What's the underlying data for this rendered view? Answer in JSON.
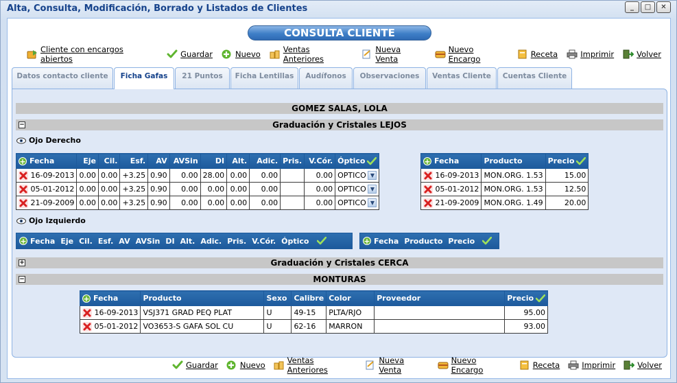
{
  "window": {
    "title": "Alta, Consulta, Modificación, Borrado y Listados de Clientes",
    "buttons": [
      "_",
      "□",
      "✕"
    ]
  },
  "header": {
    "title": "CONSULTA CLIENTE"
  },
  "toolbar_top": [
    {
      "label": "Cliente con encargos abiertos",
      "icon": "open-orders-icon"
    },
    {
      "label": "Guardar",
      "icon": "check-icon"
    },
    {
      "label": "Nuevo",
      "icon": "plus-icon"
    },
    {
      "label": "Ventas Anteriores",
      "icon": "previous-sales-icon"
    },
    {
      "label": "Nueva Venta",
      "icon": "new-sale-icon"
    },
    {
      "label": "Nuevo Encargo",
      "icon": "new-order-icon"
    },
    {
      "label": "Receta",
      "icon": "prescription-icon"
    },
    {
      "label": "Imprimir",
      "icon": "printer-icon"
    },
    {
      "label": "Volver",
      "icon": "exit-icon"
    }
  ],
  "toolbar_bottom": [
    {
      "label": "Guardar",
      "icon": "check-icon"
    },
    {
      "label": "Nuevo",
      "icon": "plus-icon"
    },
    {
      "label": "Ventas Anteriores",
      "icon": "previous-sales-icon"
    },
    {
      "label": "Nueva Venta",
      "icon": "new-sale-icon"
    },
    {
      "label": "Nuevo Encargo",
      "icon": "new-order-icon"
    },
    {
      "label": "Receta",
      "icon": "prescription-icon"
    },
    {
      "label": "Imprimir",
      "icon": "printer-icon"
    },
    {
      "label": "Volver",
      "icon": "exit-icon"
    }
  ],
  "tabs": [
    {
      "label": "Datos contacto cliente",
      "active": false
    },
    {
      "label": "Ficha Gafas",
      "active": true
    },
    {
      "label": "21 Puntos",
      "active": false
    },
    {
      "label": "Ficha Lentillas",
      "active": false
    },
    {
      "label": "Audífonos",
      "active": false
    },
    {
      "label": "Observaciones",
      "active": false
    },
    {
      "label": "Ventas Cliente",
      "active": false
    },
    {
      "label": "Cuentas Cliente",
      "active": false
    }
  ],
  "client_name": "GOMEZ SALAS, LOLA",
  "sections": {
    "lejos": {
      "title": "Graduación y Cristales LEJOS",
      "toggle": "−"
    },
    "cerca": {
      "title": "Graduación y Cristales CERCA",
      "toggle": "+"
    },
    "monturas": {
      "title": "MONTURAS",
      "toggle": "−"
    }
  },
  "ojo_derecho": {
    "label": "Ojo Derecho",
    "graduacion_headers": [
      "Fecha",
      "Eje",
      "Cil.",
      "Esf.",
      "AV",
      "AVSin",
      "DI",
      "Alt.",
      "Adic.",
      "Pris.",
      "V.Cór.",
      "Óptico"
    ],
    "graduacion_rows": [
      [
        "16-09-2013",
        "0.00",
        "0.00",
        "+3.25",
        "0.90",
        "0.00",
        "28.00",
        "0.00",
        "0.00",
        "",
        "0.00",
        "OPTICO"
      ],
      [
        "05-01-2012",
        "0.00",
        "0.00",
        "+3.25",
        "0.90",
        "0.00",
        "0.00",
        "0.00",
        "0.00",
        "",
        "0.00",
        "OPTICO"
      ],
      [
        "21-09-2009",
        "0.00",
        "0.00",
        "+3.25",
        "0.90",
        "0.00",
        "0.00",
        "0.00",
        "0.00",
        "",
        "0.00",
        "OPTICO"
      ]
    ],
    "cristales_headers": [
      "Fecha",
      "Producto",
      "Precio"
    ],
    "cristales_rows": [
      [
        "16-09-2013",
        "MON.ORG. 1.53",
        "15.00"
      ],
      [
        "05-01-2012",
        "MON.ORG. 1.53",
        "12.50"
      ],
      [
        "21-09-2009",
        "MON.ORG. 1.49",
        "20.00"
      ]
    ]
  },
  "ojo_izquierdo": {
    "label": "Ojo Izquierdo",
    "graduacion_headers": [
      "Fecha",
      "Eje",
      "Cil.",
      "Esf.",
      "AV",
      "AVSin",
      "DI",
      "Alt.",
      "Adic.",
      "Pris.",
      "V.Cór.",
      "Óptico"
    ],
    "cristales_headers": [
      "Fecha",
      "Producto",
      "Precio"
    ]
  },
  "monturas": {
    "headers": [
      "Fecha",
      "Producto",
      "Sexo",
      "Calibre",
      "Color",
      "Proveedor",
      "Precio"
    ],
    "rows": [
      [
        "16-09-2013",
        "VSJ371 GRAD PEQ PLAT",
        "U",
        "49-15",
        "PLTA/RJO",
        "",
        "95.00"
      ],
      [
        "05-01-2012",
        "VO3653-S GAFA SOL CU",
        "U",
        "62-16",
        "MARRON",
        "",
        "93.00"
      ]
    ]
  }
}
